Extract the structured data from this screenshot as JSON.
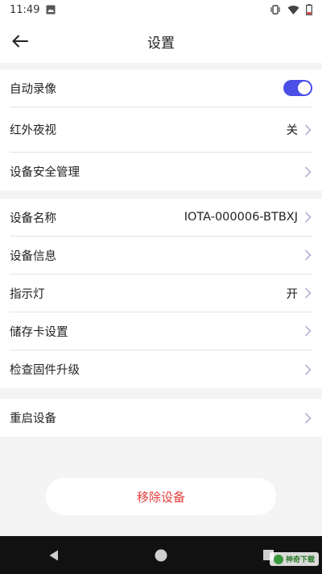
{
  "status_bar": {
    "time": "11:49"
  },
  "header": {
    "title": "设置"
  },
  "settings": {
    "group1": [
      {
        "label": "自动录像",
        "type": "toggle",
        "on": true
      },
      {
        "label": "红外夜视",
        "value": "关"
      },
      {
        "label": "设备安全管理",
        "value": ""
      }
    ],
    "group2": [
      {
        "label": "设备名称",
        "value": "IOTA-000006-BTBXJ"
      },
      {
        "label": "设备信息",
        "value": ""
      },
      {
        "label": "指示灯",
        "value": "开"
      },
      {
        "label": "储存卡设置",
        "value": ""
      },
      {
        "label": "检查固件升级",
        "value": ""
      }
    ],
    "group3": [
      {
        "label": "重启设备",
        "value": ""
      }
    ]
  },
  "remove_button": {
    "label": "移除设备"
  },
  "watermark": {
    "text": "神奇下载"
  },
  "colors": {
    "accent": "#4b4fe6",
    "danger": "#e53b3b",
    "chevron": "#b7b7d6"
  }
}
